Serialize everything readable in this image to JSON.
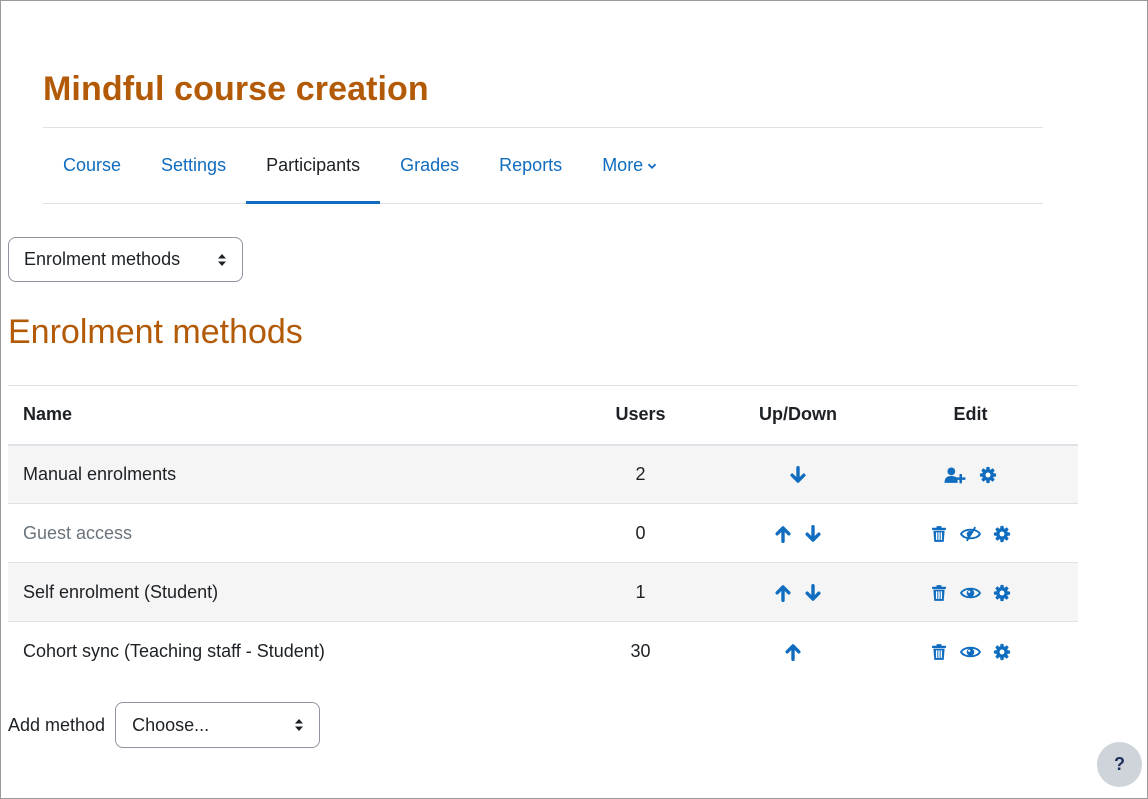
{
  "course": {
    "title": "Mindful course creation"
  },
  "nav": {
    "items": [
      {
        "label": "Course",
        "active": false
      },
      {
        "label": "Settings",
        "active": false
      },
      {
        "label": "Participants",
        "active": true
      },
      {
        "label": "Grades",
        "active": false
      },
      {
        "label": "Reports",
        "active": false
      },
      {
        "label": "More",
        "active": false,
        "icon": "chevron-down-icon"
      }
    ]
  },
  "page_selector": {
    "value": "Enrolment methods",
    "icon": "updown-caret-icon"
  },
  "page": {
    "heading": "Enrolment methods"
  },
  "table": {
    "headers": {
      "name": "Name",
      "users": "Users",
      "updown": "Up/Down",
      "edit": "Edit"
    },
    "rows": [
      {
        "name": "Manual enrolments",
        "users": "2",
        "disabled": false,
        "updown": [
          "arrow-down-icon"
        ],
        "edit": [
          "enrol-users-icon",
          "gear-icon"
        ]
      },
      {
        "name": "Guest access",
        "users": "0",
        "disabled": true,
        "updown": [
          "arrow-up-icon",
          "arrow-down-icon"
        ],
        "edit": [
          "trash-icon",
          "eye-slash-icon",
          "gear-icon"
        ]
      },
      {
        "name": "Self enrolment (Student)",
        "users": "1",
        "disabled": false,
        "updown": [
          "arrow-up-icon",
          "arrow-down-icon"
        ],
        "edit": [
          "trash-icon",
          "eye-icon",
          "gear-icon"
        ]
      },
      {
        "name": "Cohort sync (Teaching staff - Student)",
        "users": "30",
        "disabled": false,
        "updown": [
          "arrow-up-icon"
        ],
        "edit": [
          "trash-icon",
          "eye-icon",
          "gear-icon"
        ]
      }
    ]
  },
  "add_method": {
    "label": "Add method",
    "select_value": "Choose..."
  },
  "help": {
    "label": "?"
  },
  "colors": {
    "accent": "#0f6cbf",
    "heading": "#b35a07",
    "text": "#1d2125",
    "muted": "#6a737b"
  }
}
